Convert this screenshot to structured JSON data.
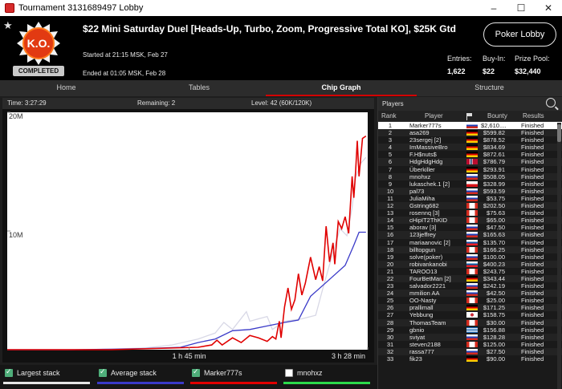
{
  "window": {
    "title": "Tournament 3131689497 Lobby"
  },
  "header": {
    "tournament_name": "$22 Mini Saturday Duel [Heads-Up, Turbo, Zoom, Progressive Total KO], $25K Gtd",
    "started": "Started at 21:15 MSK, Feb 27",
    "ended": "Ended at 01:05 MSK, Feb 28",
    "status_badge": "COMPLETED",
    "logo_text": "K.O.",
    "lobby_button": "Poker Lobby",
    "stats": [
      {
        "label": "Entries:",
        "value": "1,622"
      },
      {
        "label": "Buy-In:",
        "value": "$22"
      },
      {
        "label": "Prize Pool:",
        "value": "$32,440"
      }
    ]
  },
  "tabs": [
    "Home",
    "Tables",
    "Chip Graph",
    "Structure"
  ],
  "active_tab": "Chip Graph",
  "chart_info": {
    "time": "Time: 3:27:29",
    "remaining": "Remaining: 2",
    "level": "Level: 42 (60K/120K)"
  },
  "chart_data": {
    "type": "line",
    "y_ticks": [
      "20M",
      "10M"
    ],
    "x_ticks": [
      "1 h 45 min",
      "3 h 28 min"
    ],
    "ylim": [
      0,
      20000000
    ],
    "xlim_minutes": [
      0,
      208
    ],
    "series": [
      {
        "name": "Largest stack",
        "color": "#d8d8e6",
        "points": [
          [
            0,
            0
          ],
          [
            35,
            0
          ],
          [
            60,
            50000
          ],
          [
            80,
            150000
          ],
          [
            95,
            400000
          ],
          [
            110,
            900000
          ],
          [
            120,
            1400000
          ],
          [
            125,
            2300000
          ],
          [
            130,
            1700000
          ],
          [
            138,
            3200000
          ],
          [
            140,
            2400000
          ],
          [
            145,
            2600000
          ],
          [
            150,
            2800000
          ],
          [
            153,
            1700000
          ],
          [
            160,
            2400000
          ],
          [
            170,
            2600000
          ],
          [
            178,
            2900000
          ],
          [
            182,
            5100000
          ],
          [
            188,
            8200000
          ],
          [
            192,
            10200000
          ],
          [
            196,
            9600000
          ],
          [
            199,
            12000000
          ],
          [
            201,
            14500000
          ],
          [
            204,
            15700000
          ],
          [
            207,
            16200000
          ]
        ]
      },
      {
        "name": "Average stack",
        "color": "#3a3ac8",
        "points": [
          [
            0,
            0
          ],
          [
            40,
            0
          ],
          [
            60,
            40000
          ],
          [
            80,
            100000
          ],
          [
            100,
            200000
          ],
          [
            110,
            600000
          ],
          [
            120,
            900000
          ],
          [
            130,
            1600000
          ],
          [
            140,
            1700000
          ],
          [
            150,
            2000000
          ],
          [
            160,
            2300000
          ],
          [
            168,
            2500000
          ],
          [
            175,
            4500000
          ],
          [
            185,
            5800000
          ],
          [
            195,
            7100000
          ],
          [
            200,
            8800000
          ],
          [
            203,
            9900000
          ],
          [
            207,
            9900000
          ]
        ]
      },
      {
        "name": "Marker777s",
        "color": "#e00000",
        "points": [
          [
            0,
            0
          ],
          [
            60,
            0
          ],
          [
            110,
            200000
          ],
          [
            118,
            400000
          ],
          [
            121,
            800000
          ],
          [
            124,
            400000
          ],
          [
            130,
            1000000
          ],
          [
            135,
            600000
          ],
          [
            140,
            1200000
          ],
          [
            145,
            1000000
          ],
          [
            150,
            700000
          ],
          [
            153,
            1100000
          ],
          [
            155,
            900000
          ],
          [
            157,
            2400000
          ],
          [
            158,
            1000000
          ],
          [
            160,
            3600000
          ],
          [
            162,
            5200000
          ],
          [
            164,
            3400000
          ],
          [
            166,
            4200000
          ],
          [
            168,
            6400000
          ],
          [
            170,
            4600000
          ],
          [
            172,
            5600000
          ],
          [
            175,
            7800000
          ],
          [
            178,
            5900000
          ],
          [
            180,
            7000000
          ],
          [
            182,
            5800000
          ],
          [
            184,
            10400000
          ],
          [
            186,
            7400000
          ],
          [
            188,
            9000000
          ],
          [
            189,
            7200000
          ],
          [
            191,
            10800000
          ],
          [
            193,
            10200000
          ],
          [
            195,
            11200000
          ],
          [
            197,
            9800000
          ],
          [
            199,
            14600000
          ],
          [
            200,
            12800000
          ],
          [
            201,
            15000000
          ],
          [
            202,
            17600000
          ],
          [
            203,
            14600000
          ],
          [
            205,
            17800000
          ],
          [
            207,
            18000000
          ]
        ]
      },
      {
        "name": "mnohxz",
        "color": "#ffffff",
        "points": []
      }
    ]
  },
  "legend": [
    {
      "label": "Largest stack",
      "checked": true,
      "color": "#e6e6e6"
    },
    {
      "label": "Average stack",
      "checked": true,
      "color": "#3a3ac8"
    },
    {
      "label": "Marker777s",
      "checked": true,
      "color": "#e00000"
    },
    {
      "label": "mnohxz",
      "checked": false,
      "color": "#2bd94a"
    }
  ],
  "players": {
    "title": "Players",
    "columns": [
      "Rank",
      "Player",
      "",
      "Bounty",
      "Results"
    ],
    "rows": [
      {
        "rank": "1",
        "name": "Marker777s",
        "bounty": "$2,610....",
        "result": "Finished",
        "flag": "ru"
      },
      {
        "rank": "2",
        "name": "asa269",
        "bounty": "$599.82",
        "result": "Finished",
        "flag": "de"
      },
      {
        "rank": "3",
        "name": "23sergej [2]",
        "bounty": "$878.52",
        "result": "Finished",
        "flag": "de"
      },
      {
        "rank": "4",
        "name": "ImMassiveBro",
        "bounty": "$834.69",
        "result": "Finished",
        "flag": "de"
      },
      {
        "rank": "5",
        "name": "F.H$nuts$",
        "bounty": "$872.61",
        "result": "Finished",
        "flag": "de"
      },
      {
        "rank": "6",
        "name": "HdgHdgHdg",
        "bounty": "$786.79",
        "result": "Finished",
        "flag": "no"
      },
      {
        "rank": "7",
        "name": "Überkiller",
        "bounty": "$293.91",
        "result": "Finished",
        "flag": "de"
      },
      {
        "rank": "8",
        "name": "mnohxz",
        "bounty": "$508.05",
        "result": "Finished",
        "flag": "ru"
      },
      {
        "rank": "9",
        "name": "lukaschek.1 [2]",
        "bounty": "$328.99",
        "result": "Finished",
        "flag": "cz"
      },
      {
        "rank": "10",
        "name": "pal73",
        "bounty": "$593.59",
        "result": "Finished",
        "flag": "ru"
      },
      {
        "rank": "11",
        "name": "JuliaMiha",
        "bounty": "$53.75",
        "result": "Finished",
        "flag": "ru"
      },
      {
        "rank": "12",
        "name": "Gstring682",
        "bounty": "$202.50",
        "result": "Finished",
        "flag": "ca"
      },
      {
        "rank": "13",
        "name": "rosennq [3]",
        "bounty": "$75.63",
        "result": "Finished",
        "flag": "ca"
      },
      {
        "rank": "14",
        "name": "cHipIT2ThKID",
        "bounty": "$65.00",
        "result": "Finished",
        "flag": "ca"
      },
      {
        "rank": "15",
        "name": "aborav [3]",
        "bounty": "$47.50",
        "result": "Finished",
        "flag": "ru"
      },
      {
        "rank": "16",
        "name": "123jeffrey",
        "bounty": "$165.63",
        "result": "Finished",
        "flag": "ru"
      },
      {
        "rank": "17",
        "name": "mariaanovic [2]",
        "bounty": "$135.70",
        "result": "Finished",
        "flag": "sk"
      },
      {
        "rank": "18",
        "name": "billtopgun",
        "bounty": "$166.25",
        "result": "Finished",
        "flag": "ca"
      },
      {
        "rank": "19",
        "name": "solve(poker)",
        "bounty": "$100.00",
        "result": "Finished",
        "flag": "ru"
      },
      {
        "rank": "20",
        "name": "robivankanobi",
        "bounty": "$400.23",
        "result": "Finished",
        "flag": "si"
      },
      {
        "rank": "21",
        "name": "TAROO13",
        "bounty": "$243.75",
        "result": "Finished",
        "flag": "ca"
      },
      {
        "rank": "22",
        "name": "FourBetMan [2]",
        "bounty": "$343.44",
        "result": "Finished",
        "flag": "de"
      },
      {
        "rank": "23",
        "name": "salvador2221",
        "bounty": "$242.19",
        "result": "Finished",
        "flag": "ru"
      },
      {
        "rank": "24",
        "name": "mmilion AA",
        "bounty": "$42.50",
        "result": "Finished",
        "flag": "ru"
      },
      {
        "rank": "25",
        "name": "OO-Nasty",
        "bounty": "$25.00",
        "result": "Finished",
        "flag": "ca"
      },
      {
        "rank": "26",
        "name": "prallimall",
        "bounty": "$171.25",
        "result": "Finished",
        "flag": "de"
      },
      {
        "rank": "27",
        "name": "Yebbung",
        "bounty": "$158.75",
        "result": "Finished",
        "flag": "kr"
      },
      {
        "rank": "28",
        "name": "ThomasTeam",
        "bounty": "$30.00",
        "result": "Finished",
        "flag": "ca"
      },
      {
        "rank": "29",
        "name": "gbnio",
        "bounty": "$156.88",
        "result": "Finished",
        "flag": "gr"
      },
      {
        "rank": "30",
        "name": "sviyat",
        "bounty": "$128.28",
        "result": "Finished",
        "flag": "ru"
      },
      {
        "rank": "31",
        "name": "steven2188",
        "bounty": "$125.00",
        "result": "Finished",
        "flag": "ca"
      },
      {
        "rank": "32",
        "name": "rassa777",
        "bounty": "$27.50",
        "result": "Finished",
        "flag": "ru"
      },
      {
        "rank": "33",
        "name": "fik23",
        "bounty": "$90.00",
        "result": "Finished",
        "flag": "de"
      }
    ]
  }
}
